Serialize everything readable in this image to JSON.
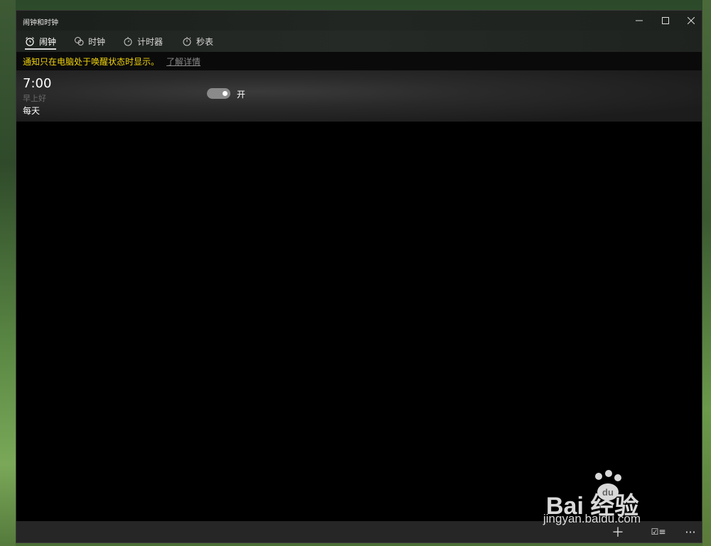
{
  "window": {
    "title": "闹钟和时钟"
  },
  "titlebar_buttons": {
    "minimize": "—",
    "maximize": "☐",
    "close": "✕"
  },
  "tabs": [
    {
      "label": "闹钟",
      "icon": "alarm-clock-icon",
      "active": true
    },
    {
      "label": "时钟",
      "icon": "world-clock-icon",
      "active": false
    },
    {
      "label": "计时器",
      "icon": "timer-icon",
      "active": false
    },
    {
      "label": "秒表",
      "icon": "stopwatch-icon",
      "active": false
    }
  ],
  "notice": {
    "message": "通知只在电脑处于唤醒状态时显示。",
    "link": "了解详情",
    "message_color": "#f2d40a"
  },
  "alarm": {
    "time": "7:00",
    "name": "早上好",
    "repeat": "每天",
    "enabled": true,
    "toggle_label": "开"
  },
  "appbar": {
    "add": "＋",
    "select": "☑≡",
    "more": "···"
  },
  "watermark": {
    "logo": "Bai  经验",
    "url": "jingyan.baidu.com"
  }
}
